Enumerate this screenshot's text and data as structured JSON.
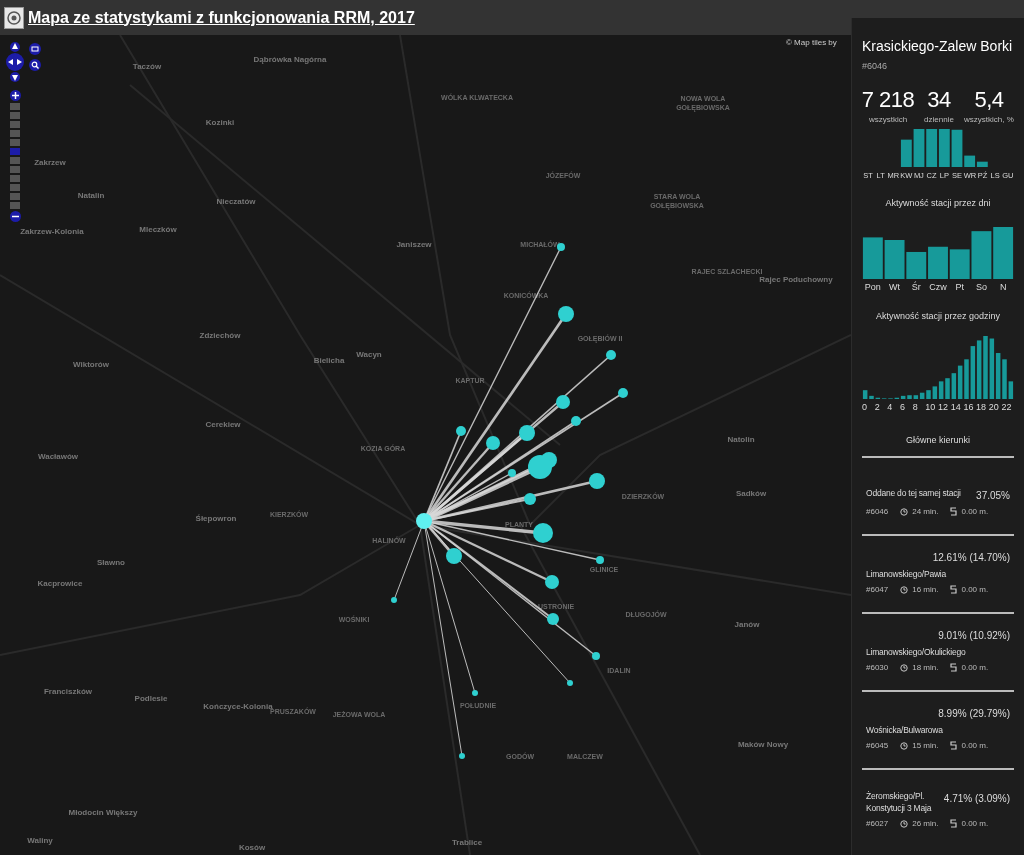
{
  "header": {
    "title": "Mapa ze statystykami z funkcjonowania RRM, 2017"
  },
  "map": {
    "attribution": "© Map tiles by",
    "zoom": {
      "level": 0.55
    },
    "places": [
      "Taczów",
      "Dąbrówka Nagórna",
      "Kozinki",
      "WÓLKA KLWATECKA",
      "NOWA WOLA GOŁĘBIOWSKA",
      "Zakrzew",
      "JÓZEFÓW",
      "Natalin",
      "Nieczatów",
      "STARA WOLA GOŁĘBIOWSKA",
      "Mleczków",
      "Zakrzew-Kolonia",
      "Janiszew",
      "MICHAŁÓW",
      "Rajec Poduchowny",
      "RAJEC SZLACHECKI",
      "KONICÓWKA",
      "Zdziechów",
      "GOŁĘBIÓW II",
      "Bielicha",
      "Wacyn",
      "Wiktorów",
      "KAPTUR",
      "Cerekiew",
      "KOZIA GÓRA",
      "Natolin",
      "Wacławów",
      "DZIERZKÓW",
      "Sadków",
      "KIERZKÓW",
      "HALINÓW",
      "PLANTY",
      "Śłepowron",
      "Sławno",
      "GLINICE",
      "Kacprowice",
      "WOŚNIKI",
      "USTRONIE",
      "DŁUGOJÓW",
      "Janów",
      "IDALIN",
      "Franciszków",
      "Podlesie",
      "Kończyce-Kolonia",
      "PRUSZAKÓW",
      "JEŻOWA WOLA",
      "POŁUDNIE",
      "Maków Nowy",
      "GODÓW",
      "MALCZEW",
      "Młodocin Większy",
      "Trablice",
      "Kosów",
      "Waliny"
    ]
  },
  "station": {
    "name": "Krasickiego-Zalew Borki",
    "id": "#6046",
    "stats": [
      {
        "value": "7 218",
        "label": "wszystkich"
      },
      {
        "value": "34",
        "label": "dziennie"
      },
      {
        "value": "5,4",
        "label": "wszystkich, %"
      }
    ],
    "month_labels": [
      "ST",
      "LT",
      "MR",
      "KW",
      "MJ",
      "CZ",
      "LP",
      "SE",
      "WR",
      "PŹ",
      "LS",
      "GU"
    ],
    "days_title": "Aktywność stacji przez dni",
    "day_labels": [
      "Pon",
      "Wt",
      "Śr",
      "Czw",
      "Pt",
      "So",
      "N"
    ],
    "hours_title": "Aktywność stacji przez godziny",
    "hour_labels": [
      "0",
      "2",
      "4",
      "6",
      "8",
      "10",
      "12",
      "14",
      "16",
      "18",
      "20",
      "22"
    ],
    "directions_title": "Główne kierunki",
    "directions": [
      {
        "kind": "inline",
        "name": "Oddane do tej samej stacji",
        "share": "37.05%",
        "id": "#6046",
        "time": "24 min.",
        "distance": "0.00 m."
      },
      {
        "kind": "stacked",
        "name": "Limanowskiego/Pawia",
        "share": "12.61% (14.70%)",
        "id": "#6047",
        "time": "16 min.",
        "distance": "0.00 m."
      },
      {
        "kind": "stacked",
        "name": "Limanowskiego/Okulickiego",
        "share": "9.01% (10.92%)",
        "id": "#6030",
        "time": "18 min.",
        "distance": "0.00 m."
      },
      {
        "kind": "stacked",
        "name": "Wośnicka/Bulwarowa",
        "share": "8.99% (29.79%)",
        "id": "#6045",
        "time": "15 min.",
        "distance": "0.00 m."
      },
      {
        "kind": "inline",
        "name": "Żeromskiego/Pl. Konstytucji 3 Maja",
        "share": "4.71% (3.09%)",
        "id": "#6027",
        "time": "26 min.",
        "distance": "0.00 m."
      }
    ]
  }
}
